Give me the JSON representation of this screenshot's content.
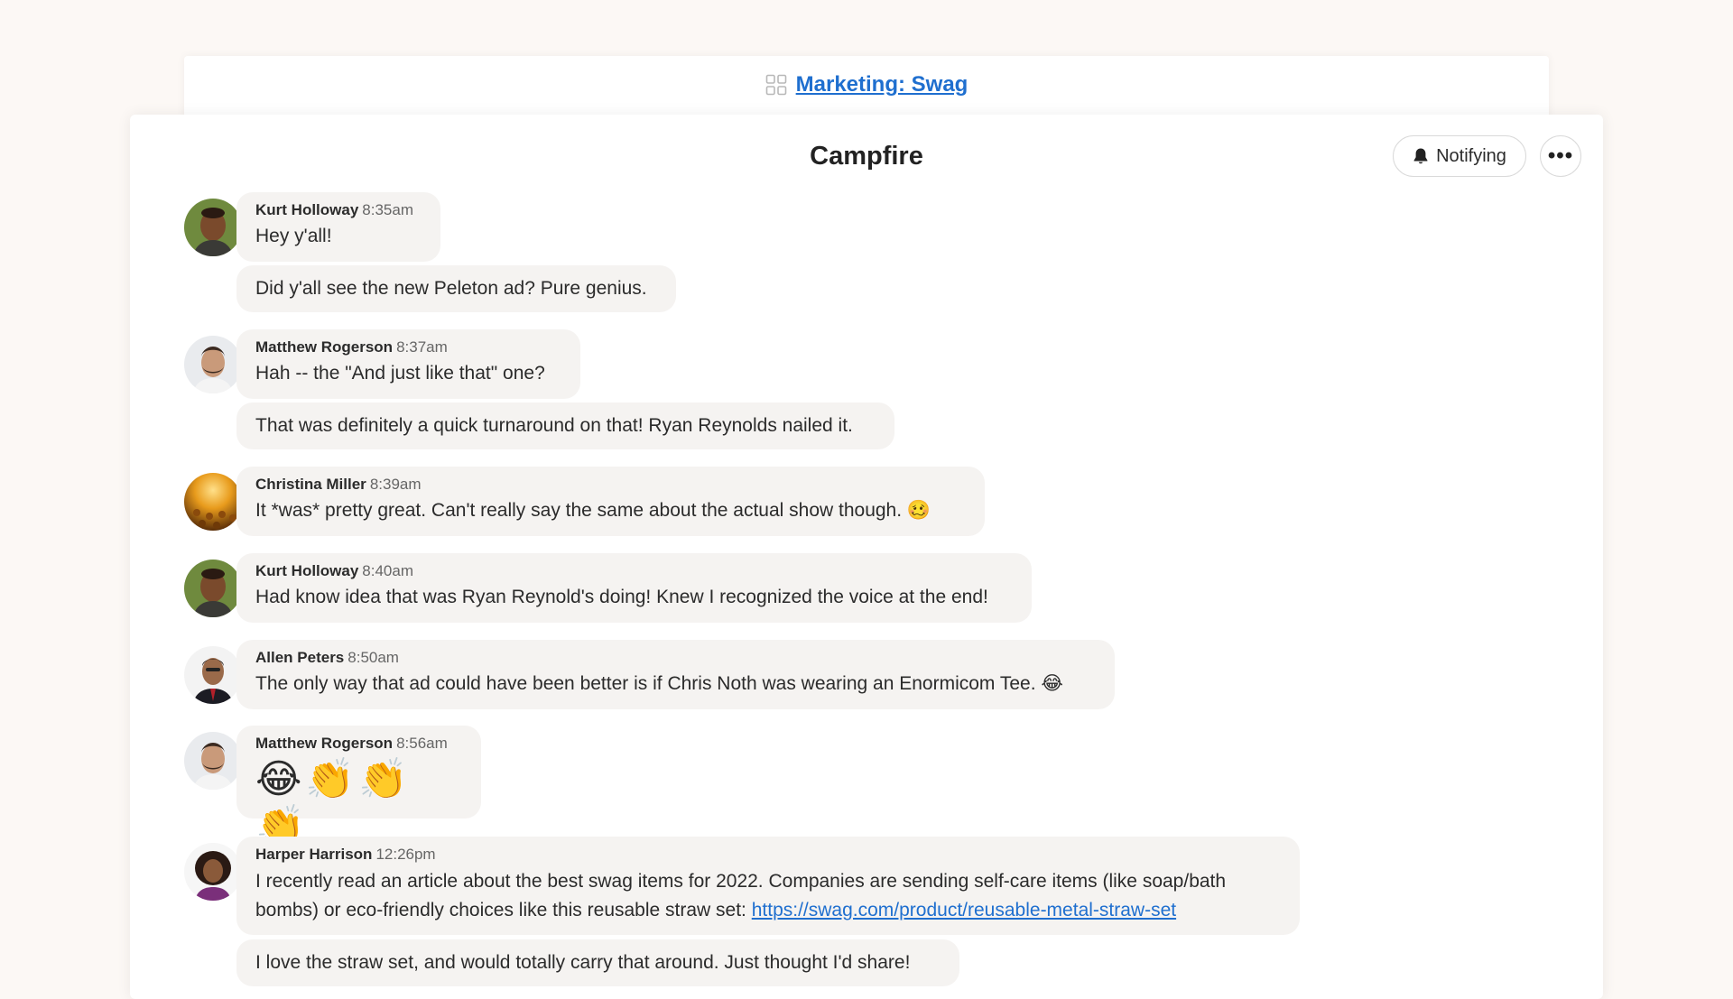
{
  "project": {
    "title": "Marketing: Swag",
    "icon": "grid-icon"
  },
  "chat": {
    "title": "Campfire",
    "notify_label": "Notifying",
    "more_label": "•••"
  },
  "messages": [
    {
      "name": "Kurt Holloway",
      "time": "8:35am",
      "text": "Hey y'all!"
    },
    {
      "text": "Did y'all see the new Peleton ad? Pure genius."
    },
    {
      "name": "Matthew Rogerson",
      "time": "8:37am",
      "text": "Hah -- the \"And just like that\" one?"
    },
    {
      "text": "That was definitely a quick turnaround on that! Ryan Reynolds nailed it."
    },
    {
      "name": "Christina Miller",
      "time": "8:39am",
      "text": "It *was* pretty great. Can't really say the same about the actual show though.",
      "emoji": "🥴"
    },
    {
      "name": "Kurt Holloway",
      "time": "8:40am",
      "text": "Had know idea that was Ryan Reynold's doing! Knew I recognized the voice at the end!"
    },
    {
      "name": "Allen Peters",
      "time": "8:50am",
      "text": "The only way that ad could have been better is if Chris Noth was wearing an Enormicom Tee.",
      "emoji": "😂"
    },
    {
      "name": "Matthew Rogerson",
      "time": "8:56am",
      "emojis": "😂👏👏👏"
    },
    {
      "name": "Harper Harrison",
      "time": "12:26pm",
      "text": "I recently read an article about the best swag items for 2022. Companies are sending self-care items (like soap/bath bombs) or eco-friendly choices like this reusable straw set:",
      "link": "https://swag.com/product/reusable-metal-straw-set"
    },
    {
      "text": "I love the straw set, and would totally carry that around. Just thought I'd share!"
    }
  ]
}
